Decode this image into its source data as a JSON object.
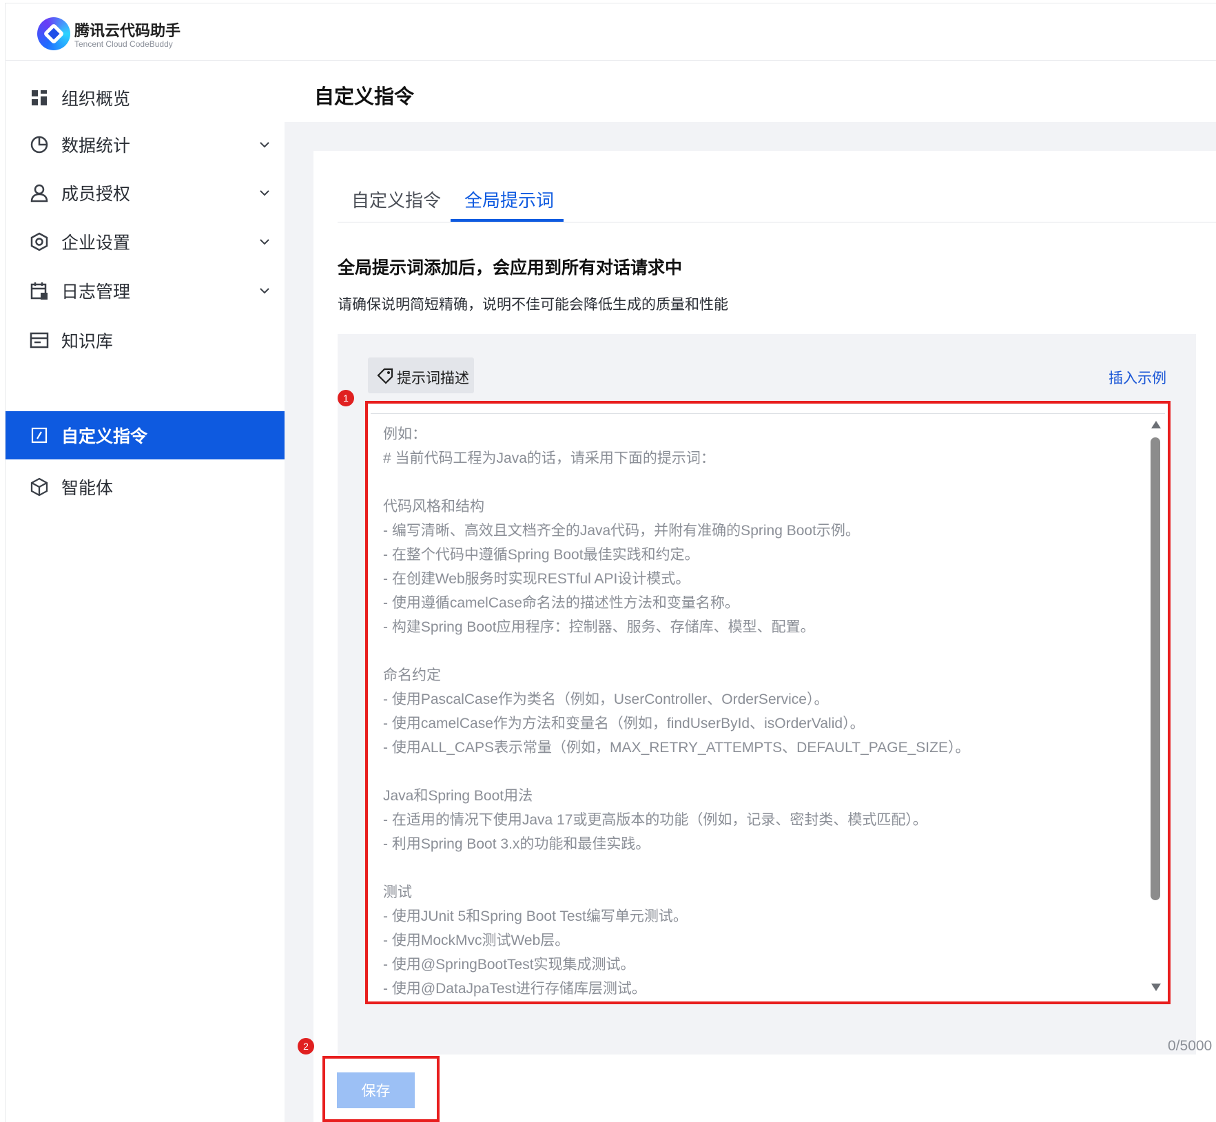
{
  "brand": {
    "title": "腾讯云代码助手",
    "subtitle": "Tencent Cloud CodeBuddy"
  },
  "sidebar": {
    "items": [
      {
        "label": "组织概览",
        "icon": "dashboard-icon",
        "expandable": false,
        "active": false
      },
      {
        "label": "数据统计",
        "icon": "pie-chart-icon",
        "expandable": true,
        "active": false
      },
      {
        "label": "成员授权",
        "icon": "user-icon",
        "expandable": true,
        "active": false
      },
      {
        "label": "企业设置",
        "icon": "settings-icon",
        "expandable": true,
        "active": false
      },
      {
        "label": "日志管理",
        "icon": "calendar-log-icon",
        "expandable": true,
        "active": false
      },
      {
        "label": "知识库",
        "icon": "knowledge-icon",
        "expandable": false,
        "active": false
      },
      {
        "label": "自定义指令",
        "icon": "edit-square-icon",
        "expandable": false,
        "active": true
      },
      {
        "label": "智能体",
        "icon": "cube-icon",
        "expandable": false,
        "active": false
      }
    ]
  },
  "page": {
    "title": "自定义指令",
    "tabs": [
      {
        "label": "自定义指令",
        "active": false
      },
      {
        "label": "全局提示词",
        "active": true
      }
    ],
    "heading": "全局提示词添加后，会应用到所有对话请求中",
    "subtext": "请确保说明简短精确，说明不佳可能会降低生成的质量和性能",
    "chip_label": "提示词描述",
    "insert_link": "插入示例",
    "textarea_placeholder": "例如：\n# 当前代码工程为Java的话，请采用下面的提示词：\n\n代码风格和结构\n- 编写清晰、高效且文档齐全的Java代码，并附有准确的Spring Boot示例。\n- 在整个代码中遵循Spring Boot最佳实践和约定。\n- 在创建Web服务时实现RESTful API设计模式。\n- 使用遵循camelCase命名法的描述性方法和变量名称。\n- 构建Spring Boot应用程序：控制器、服务、存储库、模型、配置。\n\n命名约定\n- 使用PascalCase作为类名（例如，UserController、OrderService）。\n- 使用camelCase作为方法和变量名（例如，findUserById、isOrderValid）。\n- 使用ALL_CAPS表示常量（例如，MAX_RETRY_ATTEMPTS、DEFAULT_PAGE_SIZE）。\n\nJava和Spring Boot用法\n- 在适用的情况下使用Java 17或更高版本的功能（例如，记录、密封类、模式匹配）。\n- 利用Spring Boot 3.x的功能和最佳实践。\n\n测试\n- 使用JUnit 5和Spring Boot Test编写单元测试。\n- 使用MockMvc测试Web层。\n- 使用@SpringBootTest实现集成测试。\n- 使用@DataJpaTest进行存储库层测试。",
    "counter": "0/5000",
    "save_label": "保存",
    "annotation_1": "1",
    "annotation_2": "2"
  },
  "colors": {
    "primary": "#0e5ae0",
    "highlight": "#e81e1e",
    "save_disabled": "#9cc0f5",
    "panel_bg": "#f2f3f6"
  }
}
